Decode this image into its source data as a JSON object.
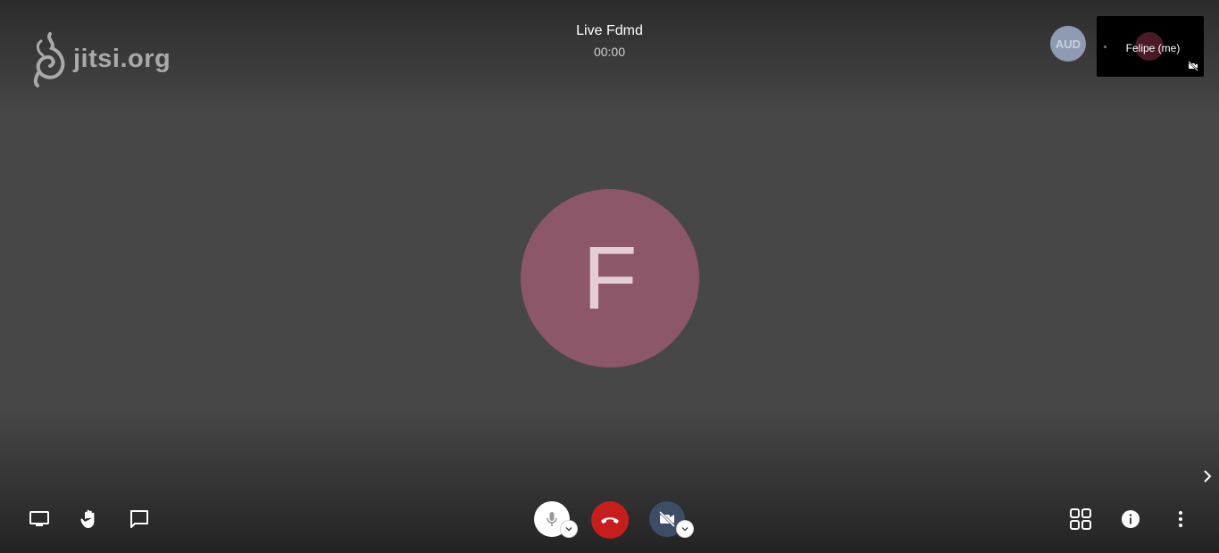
{
  "logo": {
    "text": "jitsi.org"
  },
  "conference": {
    "title": "Live Fdmd",
    "timer": "00:00"
  },
  "filmstrip": {
    "audio_avatar": "AUD",
    "local_participant_name": "Felipe (me)"
  },
  "stage": {
    "avatar_initial": "F",
    "avatar_color": "#8c5769"
  },
  "toolbar": {
    "left": [
      "desktop-share-icon",
      "raise-hand-icon",
      "chat-icon"
    ],
    "center": [
      "microphone-icon",
      "hangup-icon",
      "camera-off-icon"
    ],
    "right": [
      "tile-view-icon",
      "info-icon",
      "more-options-icon"
    ],
    "hangup_color": "#c71d1d",
    "camera_button_color": "#3d4d66"
  }
}
